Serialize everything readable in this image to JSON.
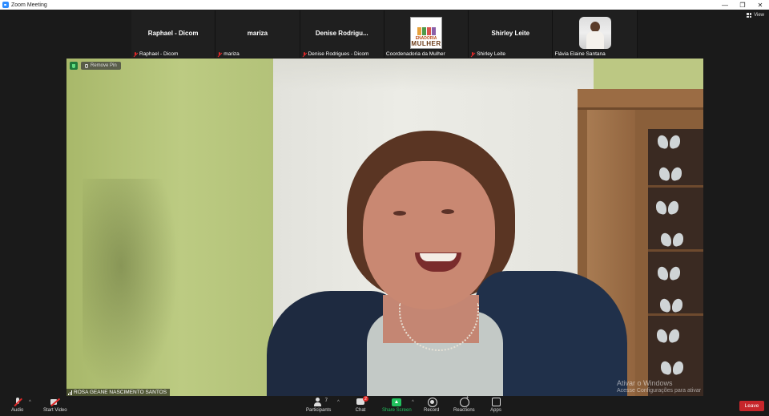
{
  "window": {
    "title": "Zoom Meeting",
    "minimize": "—",
    "maximize": "❐",
    "close": "✕"
  },
  "view_button": "View",
  "participants_strip": [
    {
      "display_name": "Raphael - Dicom",
      "label": "Raphael - Dicom",
      "muted": true
    },
    {
      "display_name": "mariza",
      "label": "mariza",
      "muted": true
    },
    {
      "display_name": "Denise  Rodrigu...",
      "label": "Denise Rodrigues - Dicom",
      "muted": true
    },
    {
      "display_name": "",
      "label": "Coordenadoria da Mulher",
      "muted": false,
      "logo_line1": "ENADORIA",
      "logo_line2": "MULHER"
    },
    {
      "display_name": "Shirley Leite",
      "label": "Shirley Leite",
      "muted": true
    },
    {
      "display_name": "",
      "label": "Flávia Elaine Santana",
      "muted": false
    }
  ],
  "main_video": {
    "remove_pin": "Remove Pin",
    "speaker_name": "ROSA GEANE NASCIMENTO SANTOS",
    "watermark_line1": "Ativar o Windows",
    "watermark_line2": "Acesse Configurações para ativar o Windows."
  },
  "toolbar": {
    "audio": "Audio",
    "start_video": "Start Video",
    "participants": "Participants",
    "participants_count": "7",
    "chat": "Chat",
    "chat_badge": "2",
    "share_screen": "Share Screen",
    "record": "Record",
    "reactions": "Reactions",
    "apps": "Apps",
    "leave": "Leave",
    "caret": "^"
  },
  "colors": {
    "share_green": "#22c15e",
    "leave_red": "#c7262b",
    "muted_red": "#e02828",
    "zoom_blue": "#2d8cff"
  }
}
